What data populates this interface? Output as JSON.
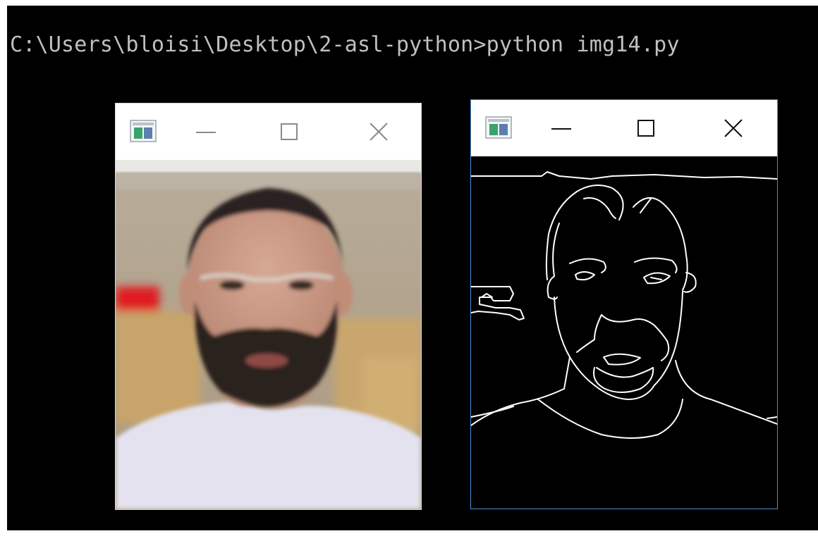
{
  "terminal": {
    "prompt_text": "C:\\Users\\bloisi\\Desktop\\2-asl-python>python img14.py",
    "background": "#000000",
    "text_color": "#c0c0c0"
  },
  "windows": [
    {
      "name": "color-image-window",
      "state": "inactive",
      "icons": [
        "app-icon",
        "minimize-icon",
        "maximize-icon",
        "close-icon"
      ],
      "content": "color webcam frame"
    },
    {
      "name": "edges-image-window",
      "state": "active",
      "icons": [
        "app-icon",
        "minimize-icon",
        "maximize-icon",
        "close-icon"
      ],
      "content": "canny edge map"
    }
  ],
  "colors": {
    "active_border": "#4a90d9",
    "inactive_border": "#d9d9d9",
    "edge_lines": "#ffffff",
    "wall": "#b8ab97",
    "skin": "#c89a84",
    "beard": "#2e2521",
    "shirt": "#e4e3ef"
  }
}
